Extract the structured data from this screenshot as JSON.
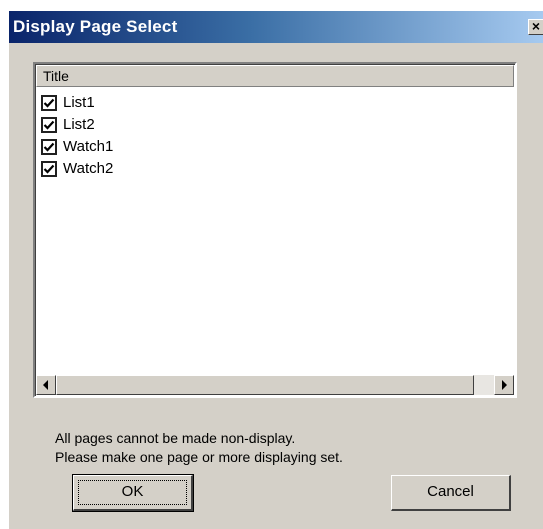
{
  "window": {
    "title": "Display Page Select",
    "close_glyph": "×"
  },
  "list": {
    "column_header": "Title",
    "items": [
      {
        "label": "List1",
        "checked": true
      },
      {
        "label": "List2",
        "checked": true
      },
      {
        "label": "Watch1",
        "checked": true
      },
      {
        "label": "Watch2",
        "checked": true
      }
    ],
    "scroll_left_icon": "arrow-left-icon",
    "scroll_right_icon": "arrow-right-icon"
  },
  "message": {
    "line1": "All pages cannot be made non-display.",
    "line2": "Please make one page or more displaying set."
  },
  "buttons": {
    "ok_label": "OK",
    "cancel_label": "Cancel"
  },
  "colors": {
    "titlebar_start": "#0a246a",
    "titlebar_end": "#a6caf0",
    "dialog_face": "#d4d0c8"
  }
}
